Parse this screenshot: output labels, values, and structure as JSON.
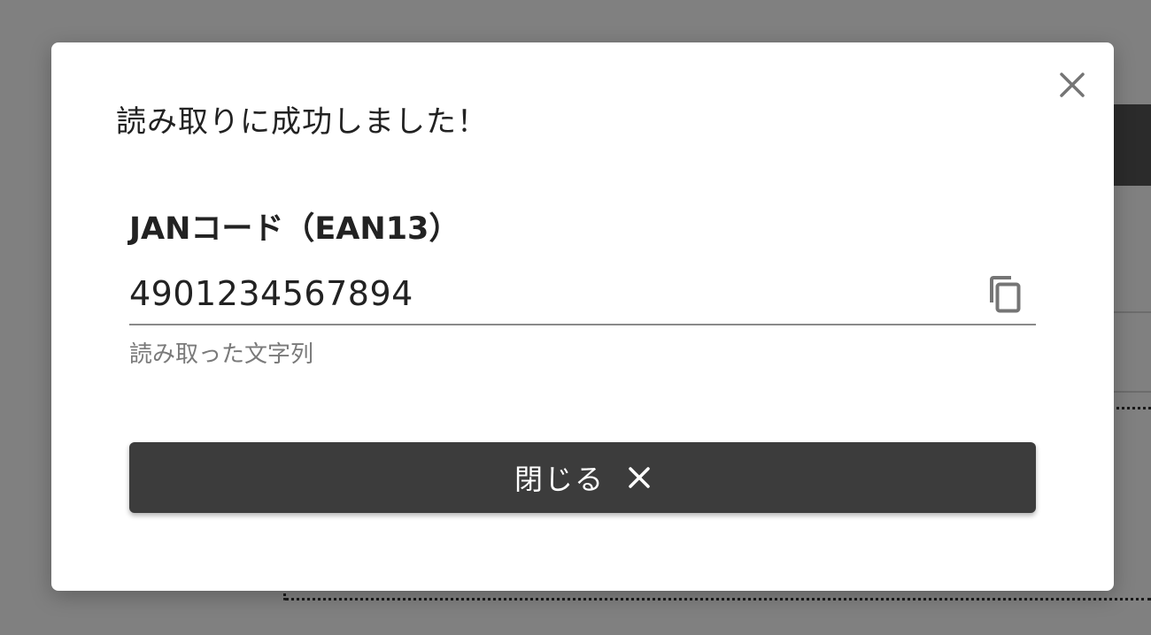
{
  "dialog": {
    "title": "読み取りに成功しました！",
    "close_icon": "close-icon",
    "field": {
      "label": "JANコード（EAN13）",
      "value": "4901234567894",
      "helper": "読み取った文字列",
      "copy_icon": "copy-icon"
    },
    "close_button": {
      "label": "閉じる",
      "icon": "close-icon"
    }
  },
  "colors": {
    "overlay": "#808080",
    "dialog_background": "#ffffff",
    "button_background": "#3c3c3c",
    "button_text": "#ffffff",
    "helper_text": "#7a7a7a",
    "icon": "#757575"
  }
}
